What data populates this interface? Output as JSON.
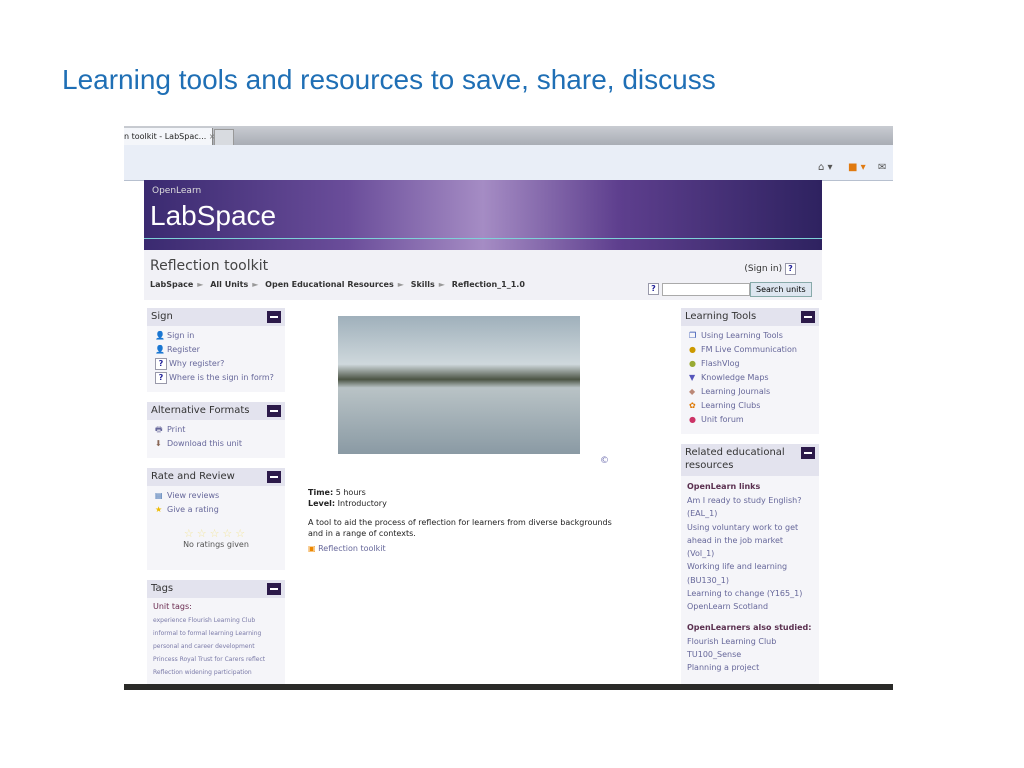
{
  "slide_title": "Learning tools and resources to save, share, discuss",
  "browser": {
    "tab_title": "n toolkit - LabSpac...",
    "tab_close": "×"
  },
  "banner": {
    "brand_small": "OpenLearn",
    "brand_large": "LabSpace"
  },
  "header": {
    "title": "Reflection toolkit",
    "sign_in": "(Sign in)",
    "help": "?",
    "search_button": "Search units",
    "search_value": "",
    "breadcrumbs": [
      "LabSpace",
      "All Units",
      "Open Educational Resources",
      "Skills",
      "Reflection_1_1.0"
    ]
  },
  "left": {
    "sign": {
      "title": "Sign",
      "items": [
        "Sign in",
        "Register",
        "Why register?",
        "Where is the sign in form?"
      ]
    },
    "formats": {
      "title": "Alternative Formats",
      "items": [
        "Print",
        "Download this unit"
      ]
    },
    "rate": {
      "title": "Rate and Review",
      "items": [
        "View reviews",
        "Give a rating"
      ],
      "rating_text": "No ratings given",
      "stars": 0
    },
    "tags": {
      "title": "Tags",
      "label": "Unit tags:",
      "text": "experience Flourish Learning Club informal to formal learning Learning personal and career development Princess Royal Trust for Carers reflect Reflection widening participation"
    }
  },
  "main": {
    "copyright": "©",
    "time_label": "Time:",
    "time": "5 hours",
    "level_label": "Level:",
    "level": "Introductory",
    "description": "A tool to aid the process of reflection for learners from diverse backgrounds and in a range of contexts.",
    "link": "Reflection toolkit"
  },
  "right": {
    "tools": {
      "title": "Learning Tools",
      "items": [
        "Using Learning Tools",
        "FM Live Communication",
        "FlashVlog",
        "Knowledge Maps",
        "Learning Journals",
        "Learning Clubs",
        "Unit forum"
      ]
    },
    "related": {
      "title": "Related educational resources",
      "links_label": "OpenLearn links",
      "links": [
        "Am I ready to study English? (EAL_1)",
        "Using voluntary work to get ahead in the job market (Vol_1)",
        "Working life and learning (BU130_1)",
        "Learning to change (Y165_1)",
        "OpenLearn Scotland"
      ],
      "also_label": "OpenLearners also studied:",
      "also": [
        "Flourish Learning Club",
        "TU100_Sense",
        "Planning a project"
      ]
    }
  }
}
